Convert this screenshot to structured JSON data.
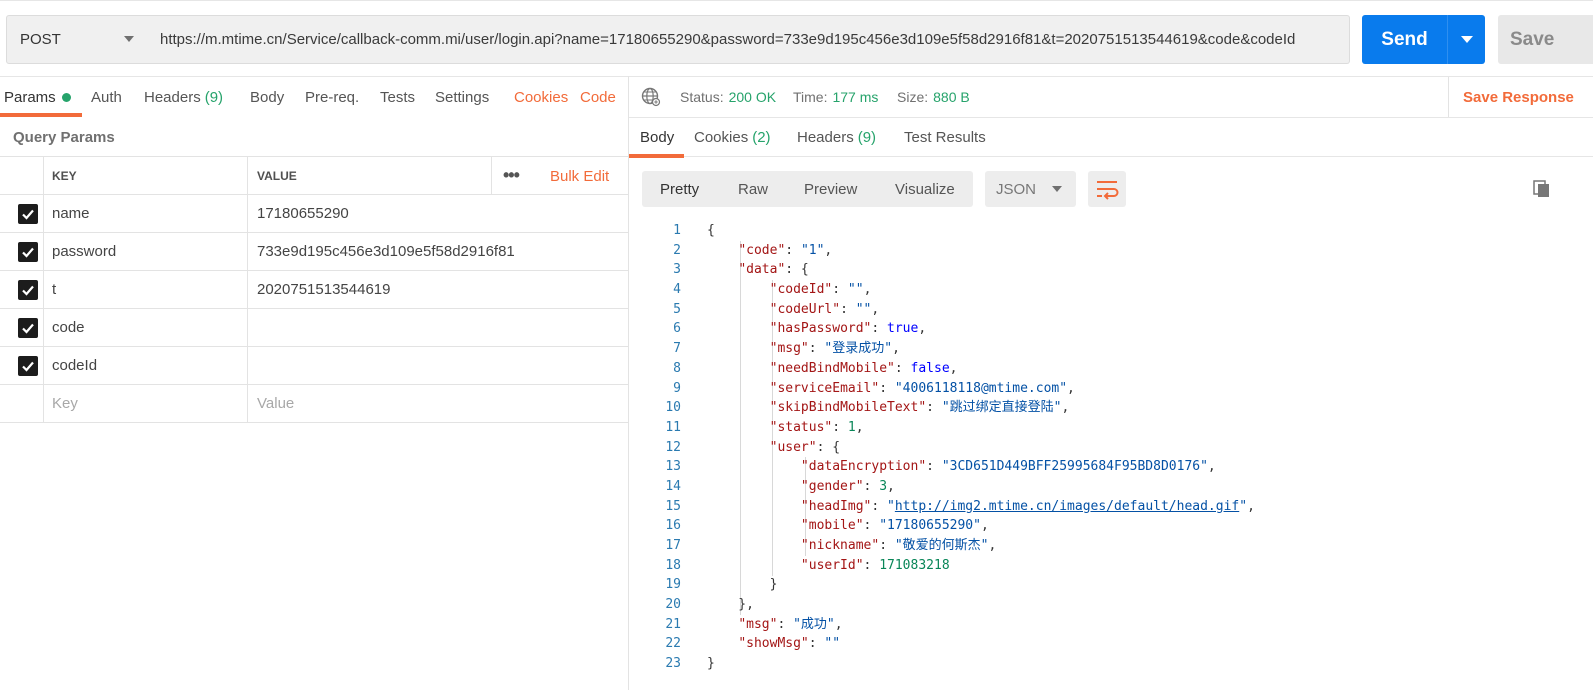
{
  "request": {
    "method": "POST",
    "url": "https://m.mtime.cn/Service/callback-comm.mi/user/login.api?name=17180655290&password=733e9d195c456e3d109e5f58d2916f81&t=2020751513544619&code&codeId",
    "send_label": "Send",
    "save_label": "Save"
  },
  "request_tabs": {
    "params": "Params",
    "auth": "Auth",
    "headers": "Headers",
    "headers_count": "(9)",
    "body": "Body",
    "prereq": "Pre-req.",
    "tests": "Tests",
    "settings": "Settings",
    "cookies": "Cookies",
    "code": "Code"
  },
  "query_params": {
    "title": "Query Params",
    "col_key": "KEY",
    "col_value": "VALUE",
    "more": "•••",
    "bulk_edit": "Bulk Edit",
    "rows": [
      {
        "key": "name",
        "value": "17180655290"
      },
      {
        "key": "password",
        "value": "733e9d195c456e3d109e5f58d2916f81"
      },
      {
        "key": "t",
        "value": "2020751513544619"
      },
      {
        "key": "code",
        "value": ""
      },
      {
        "key": "codeId",
        "value": ""
      }
    ],
    "placeholder_key": "Key",
    "placeholder_value": "Value"
  },
  "response": {
    "status_label": "Status:",
    "status_value": "200 OK",
    "time_label": "Time:",
    "time_value": "177 ms",
    "size_label": "Size:",
    "size_value": "880 B",
    "save_response": "Save Response",
    "tabs": {
      "body": "Body",
      "cookies": "Cookies",
      "cookies_count": "(2)",
      "headers": "Headers",
      "headers_count": "(9)",
      "test_results": "Test Results"
    },
    "formats": {
      "pretty": "Pretty",
      "raw": "Raw",
      "preview": "Preview",
      "visualize": "Visualize"
    },
    "language": "JSON"
  },
  "colors": {
    "accent": "#f26b3a",
    "send": "#097bed",
    "ok": "#26a36b"
  }
}
